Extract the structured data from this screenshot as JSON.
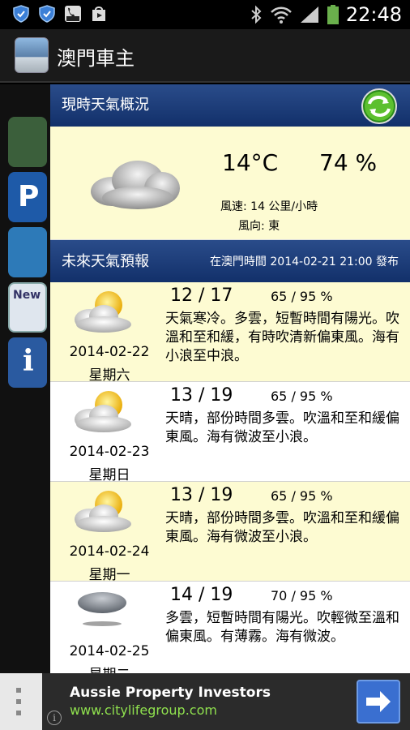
{
  "status_bar": {
    "time": "22:48",
    "icons_left": [
      "shield-icon",
      "shield-icon",
      "talk-free-icon",
      "play-store-icon"
    ],
    "icons_right": [
      "bluetooth-icon",
      "wifi-icon",
      "signal-icon",
      "battery-icon"
    ]
  },
  "app": {
    "title": "澳門車主"
  },
  "current": {
    "header": "現時天氣概況",
    "temperature": "14°C",
    "humidity": "74 %",
    "wind_speed": "風速: 14 公里/小時",
    "wind_direction": "風向: 東",
    "icon": "cloudy-icon"
  },
  "forecast": {
    "header": "未來天氣預報",
    "issued": "在澳門時間 2014-02-21 21:00 發布",
    "days": [
      {
        "temp": "12 / 17",
        "humidity": "65 / 95 %",
        "text": "天氣寒冷。多雲，短暫時間有陽光。吹溫和至和緩，有時吹清新偏東風。海有小浪至中浪。",
        "date": "2014-02-22",
        "weekday": "星期六",
        "icon": "sun-cloud-icon"
      },
      {
        "temp": "13 / 19",
        "humidity": "65 / 95 %",
        "text": "天晴，部份時間多雲。吹溫和至和緩偏東風。海有微波至小浪。",
        "date": "2014-02-23",
        "weekday": "星期日",
        "icon": "sun-cloud-icon"
      },
      {
        "temp": "13 / 19",
        "humidity": "65 / 95 %",
        "text": "天晴，部份時間多雲。吹溫和至和緩偏東風。海有微波至小浪。",
        "date": "2014-02-24",
        "weekday": "星期一",
        "icon": "sun-cloud-icon"
      },
      {
        "temp": "14 / 19",
        "humidity": "70 / 95 %",
        "text": "多雲，短暫時間有陽光。吹輕微至溫和偏東風。有薄霧。海有微波。",
        "date": "2014-02-25",
        "weekday": "星期二",
        "icon": "fog-cloud-icon"
      }
    ]
  },
  "ad": {
    "title": "Aussie Property Investors",
    "url": "www.citylifegroup.com",
    "info": "i"
  },
  "colors": {
    "header_blue": "#1e3f7e",
    "alt_row": "#fdfbd2",
    "ad_url_green": "#8fe04e",
    "ad_button_blue": "#3a6fd0"
  }
}
